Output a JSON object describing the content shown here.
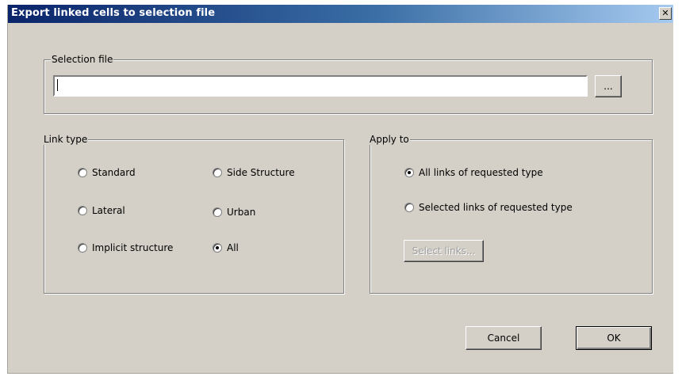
{
  "window": {
    "title": "Export linked cells to selection file",
    "close_glyph": "✕"
  },
  "selection_file": {
    "legend": "Selection file",
    "value": "",
    "browse_label": "..."
  },
  "link_type": {
    "legend": "Link type",
    "options": [
      {
        "label": "Standard",
        "selected": false
      },
      {
        "label": "Side Structure",
        "selected": false
      },
      {
        "label": "Lateral",
        "selected": false
      },
      {
        "label": "Urban",
        "selected": false
      },
      {
        "label": "Implicit structure",
        "selected": false
      },
      {
        "label": "All",
        "selected": true
      }
    ]
  },
  "apply_to": {
    "legend": "Apply to",
    "options": [
      {
        "label": "All links of requested type",
        "selected": true
      },
      {
        "label": "Selected links of requested type",
        "selected": false
      }
    ],
    "select_links_label": "Select links..."
  },
  "buttons": {
    "cancel": "Cancel",
    "ok": "OK"
  }
}
